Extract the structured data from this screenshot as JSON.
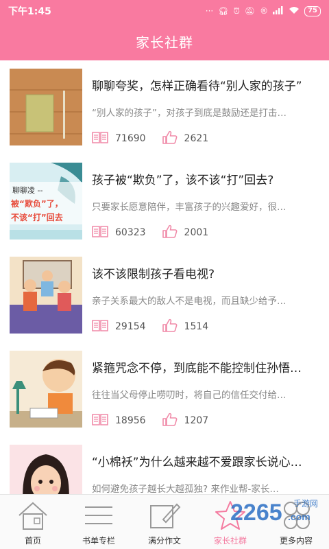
{
  "status": {
    "time": "下午1:45",
    "battery": "75"
  },
  "header": {
    "title": "家长社群"
  },
  "articles": [
    {
      "title": "聊聊夸奖，怎样正确看待“别人家的孩子”",
      "desc": "“别人家的孩子”，对孩子到底是鼓励还是打击…",
      "views": "71690",
      "likes": "2621",
      "thumb_icon": "notebook-on-desk"
    },
    {
      "title": "孩子被“欺负”了，该不该“打”回去?",
      "desc": "只要家长愿意陪伴，丰富孩子的兴趣爱好，很…",
      "views": "60323",
      "likes": "2001",
      "thumb_icon": "speech-cover",
      "thumb_text_1": "聊聊凌 --",
      "thumb_text_2": "被“欺负”了，",
      "thumb_text_3": "不该“打”回去"
    },
    {
      "title": "该不该限制孩子看电视?",
      "desc": "亲子关系最大的敌人不是电视，而且缺少给予…",
      "views": "29154",
      "likes": "1514",
      "thumb_icon": "family-illustration"
    },
    {
      "title": "紧箍咒念不停，到底能不能控制住孙悟…",
      "desc": "往往当父母停止唠叨时，将自己的信任交付给…",
      "views": "18956",
      "likes": "1207",
      "thumb_icon": "child-studying"
    },
    {
      "title": "“小棉袄”为什么越来越不爱跟家长说心…",
      "desc": "如何避免孩子越长大越孤独? 来作业帮-家长…",
      "views": "",
      "likes": "",
      "thumb_icon": "girl-portrait"
    }
  ],
  "tabs": [
    {
      "label": "首页",
      "icon": "house-icon"
    },
    {
      "label": "书单专栏",
      "icon": "list-icon"
    },
    {
      "label": "满分作文",
      "icon": "pencil-icon"
    },
    {
      "label": "家长社群",
      "icon": "star-icon"
    },
    {
      "label": "更多内容",
      "icon": "more-icon"
    }
  ],
  "watermark": {
    "brand": "2265",
    "suffix": ".com",
    "sub": "手游网"
  },
  "colors": {
    "accent": "#f97aa0",
    "tab_active": "#f47ba0",
    "meta_icon": "#f08aa8"
  }
}
